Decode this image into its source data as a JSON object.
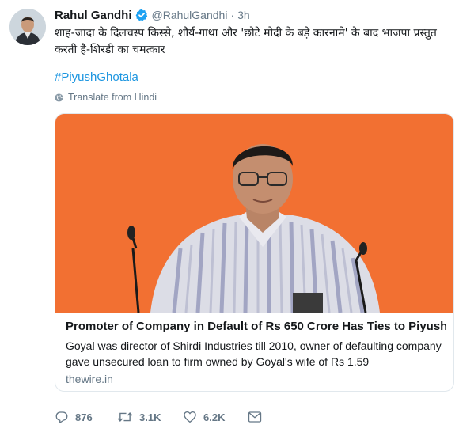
{
  "tweet": {
    "name": "Rahul Gandhi",
    "handle": "@RahulGandhi",
    "separator": "·",
    "time": "3h",
    "text": "शाह-जादा के दिलचस्प किस्से, शौर्य-गाथा और 'छोटे मोदी के बड़े कारनामे' के बाद भाजपा प्रस्तुत करती है-शिरडी का चमत्कार",
    "hashtag": "#PiyushGhotala",
    "translate_label": "Translate from Hindi"
  },
  "card": {
    "title": "Promoter of Company in Default of Rs 650 Crore Has Ties to Piyush ...",
    "description": "Goyal was director of Shirdi Industries till 2010, owner of defaulting company gave unsecured loan to firm owned by Goyal's wife of Rs 1.59",
    "domain": "thewire.in"
  },
  "actions": {
    "replies": "876",
    "retweets": "3.1K",
    "likes": "6.2K"
  },
  "colors": {
    "link": "#1b95e0",
    "secondary": "#657786",
    "card_background": "#f26a2e",
    "verified": "#1da1f2"
  },
  "icons": [
    "verified-badge-icon",
    "globe-icon",
    "reply-icon",
    "retweet-icon",
    "like-icon",
    "direct-message-icon"
  ]
}
